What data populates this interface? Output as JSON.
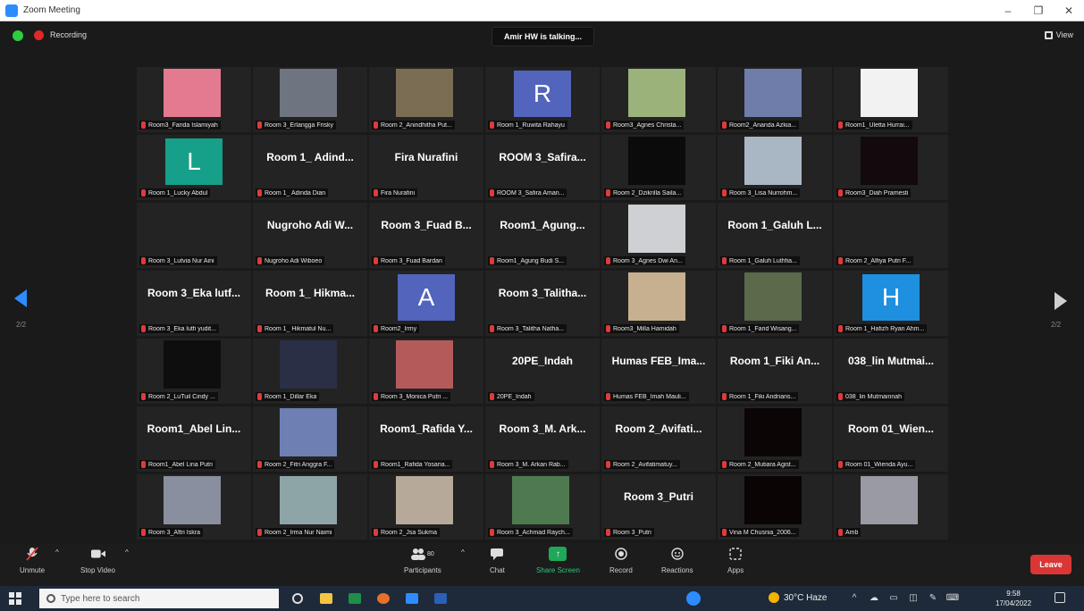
{
  "window": {
    "title": "Zoom Meeting",
    "controls": [
      "–",
      "❐",
      "✕"
    ]
  },
  "meeting": {
    "recording_label": "Recording",
    "talking": "Amir HW is talking...",
    "view_label": "View",
    "page_prev": "2/2",
    "page_next": "2/2",
    "tiles": [
      {
        "label": "Room3_Farida Islamiyah",
        "kind": "video",
        "color": "#e37a8f"
      },
      {
        "label": "Room 3_Erlangga Frisky",
        "kind": "video",
        "color": "#6e7480"
      },
      {
        "label": "Room 2_Anindhitha Put...",
        "kind": "video",
        "color": "#7a6d53"
      },
      {
        "label": "Room 1_Ruwita Rahayu",
        "kind": "avatar",
        "letter": "R",
        "color": "#5364bc"
      },
      {
        "label": "Room3_Agnes Christa...",
        "kind": "video",
        "color": "#9bb27a"
      },
      {
        "label": "Room2_Ananda Azkia...",
        "kind": "video",
        "color": "#6f7dab"
      },
      {
        "label": "Room1_Uletta Hurrai...",
        "kind": "video",
        "color": "#f2f2f2"
      },
      {
        "label": "Room 1_Lucky Abdul",
        "kind": "avatar",
        "letter": "L",
        "color": "#16a08a"
      },
      {
        "label": "Room 1_ Adinda Dian",
        "kind": "name",
        "name": "Room 1_ Adind..."
      },
      {
        "label": "Fira Nurafini",
        "kind": "name",
        "name": "Fira Nurafini"
      },
      {
        "label": "ROOM 3_Safira Aman...",
        "kind": "name",
        "name": "ROOM 3_Safira..."
      },
      {
        "label": "Room 2_Dzikrilla Saila...",
        "kind": "video",
        "color": "#0b0b0b"
      },
      {
        "label": "Room 3_Lisa Nurrohm...",
        "kind": "video",
        "color": "#a9b6c4"
      },
      {
        "label": "Room3_Diah Pramesti",
        "kind": "video",
        "color": "#120a0c"
      },
      {
        "label": "Room 3_Lutvia Nur Aini",
        "kind": "name",
        "name": ""
      },
      {
        "label": "Nugroho Adi Wiboeo",
        "kind": "name",
        "name": "Nugroho Adi W..."
      },
      {
        "label": "Room 3_Fuad Bardan",
        "kind": "name",
        "name": "Room 3_Fuad B..."
      },
      {
        "label": "Room1_Agung Budi S...",
        "kind": "name",
        "name": "Room1_Agung..."
      },
      {
        "label": "Room 3_Agnes Dwi An...",
        "kind": "video",
        "color": "#cfd0d3"
      },
      {
        "label": "Room 1_Galuh Luthfia...",
        "kind": "name",
        "name": "Room 1_Galuh L..."
      },
      {
        "label": "Room 2_Alfiya Putri F...",
        "kind": "name",
        "name": ""
      },
      {
        "label": "Room 3_Eka lutfi yudit...",
        "kind": "name",
        "name": "Room 3_Eka lutf..."
      },
      {
        "label": "Room 1_ Hikmatul Nu...",
        "kind": "name",
        "name": "Room 1_ Hikma..."
      },
      {
        "label": "Room2_Irmy",
        "kind": "avatar",
        "letter": "A",
        "color": "#5364bc"
      },
      {
        "label": "Room 3_Talitha Natha...",
        "kind": "name",
        "name": "Room 3_Talitha..."
      },
      {
        "label": "Room3_Milla Hamidah",
        "kind": "video",
        "color": "#c7b08f"
      },
      {
        "label": "Room 1_Farid Wisang...",
        "kind": "video",
        "color": "#5a6a4a"
      },
      {
        "label": "Room 1_Hafizh Ryan Ahm...",
        "kind": "avatar",
        "letter": "H",
        "color": "#1f8fe0"
      },
      {
        "label": "Room 2_LuTuil Cindy ...",
        "kind": "video",
        "color": "#0e0e0e"
      },
      {
        "label": "Room 1_Dillar Eka",
        "kind": "video",
        "color": "#2a2f45"
      },
      {
        "label": "Room 3_Monica Putri ...",
        "kind": "video",
        "color": "#b55a5a"
      },
      {
        "label": "20PE_Indah",
        "kind": "name",
        "name": "20PE_Indah"
      },
      {
        "label": "Humas FEB_Imah Mauli...",
        "kind": "name",
        "name": "Humas FEB_Ima..."
      },
      {
        "label": "Room 1_Fiki Andrians...",
        "kind": "name",
        "name": "Room 1_Fiki An..."
      },
      {
        "label": "038_lin Mutmainnah",
        "kind": "name",
        "name": "038_lin Mutmai..."
      },
      {
        "label": "Room1_Abel Lina Putri",
        "kind": "name",
        "name": "Room1_Abel Lin..."
      },
      {
        "label": "Room 2_Fitri Anggra F...",
        "kind": "video",
        "color": "#6d7fb3"
      },
      {
        "label": "Room1_Rafida Yosaria...",
        "kind": "name",
        "name": "Room1_Rafida Y..."
      },
      {
        "label": "Room 3_M. Arkan Rab...",
        "kind": "name",
        "name": "Room 3_M. Ark..."
      },
      {
        "label": "Room 2_Avifatimatuy...",
        "kind": "name",
        "name": "Room 2_Avifati..."
      },
      {
        "label": "Room 2_Mutiara Agist...",
        "kind": "video",
        "color": "#0c0505"
      },
      {
        "label": "Room 01_Wienda Ayu...",
        "kind": "name",
        "name": "Room 01_Wien..."
      },
      {
        "label": "Room 3_Aftri Iskra",
        "kind": "video",
        "color": "#8a8fa0"
      },
      {
        "label": "Room 2_Irma Nur Naimi",
        "kind": "video",
        "color": "#8ea5a8"
      },
      {
        "label": "Room 2_Jsa Sukma",
        "kind": "video",
        "color": "#b7a99a"
      },
      {
        "label": "Room 3_Achmad Raych...",
        "kind": "video",
        "color": "#4f7a4f"
      },
      {
        "label": "Room 3_Putri",
        "kind": "name",
        "name": "Room 3_Putri"
      },
      {
        "label": "Vina M Chusnia_2006...",
        "kind": "video",
        "color": "#0a0404"
      },
      {
        "label": "Amb",
        "kind": "video",
        "color": "#9a9aa4"
      }
    ]
  },
  "toolbar": {
    "unmute": "Unmute",
    "stop_video": "Stop Video",
    "participants": "Participants",
    "participant_count": "80",
    "chat": "Chat",
    "share_screen": "Share Screen",
    "record": "Record",
    "reactions": "Reactions",
    "apps": "Apps",
    "leave": "Leave"
  },
  "taskbar": {
    "search_placeholder": "Type here to search",
    "weather": "30°C Haze",
    "time": "9:58",
    "date": "17/04/2022"
  },
  "colors": {
    "accent": "#2D8CFF",
    "leave": "#d93636",
    "share": "#1fa85a"
  }
}
